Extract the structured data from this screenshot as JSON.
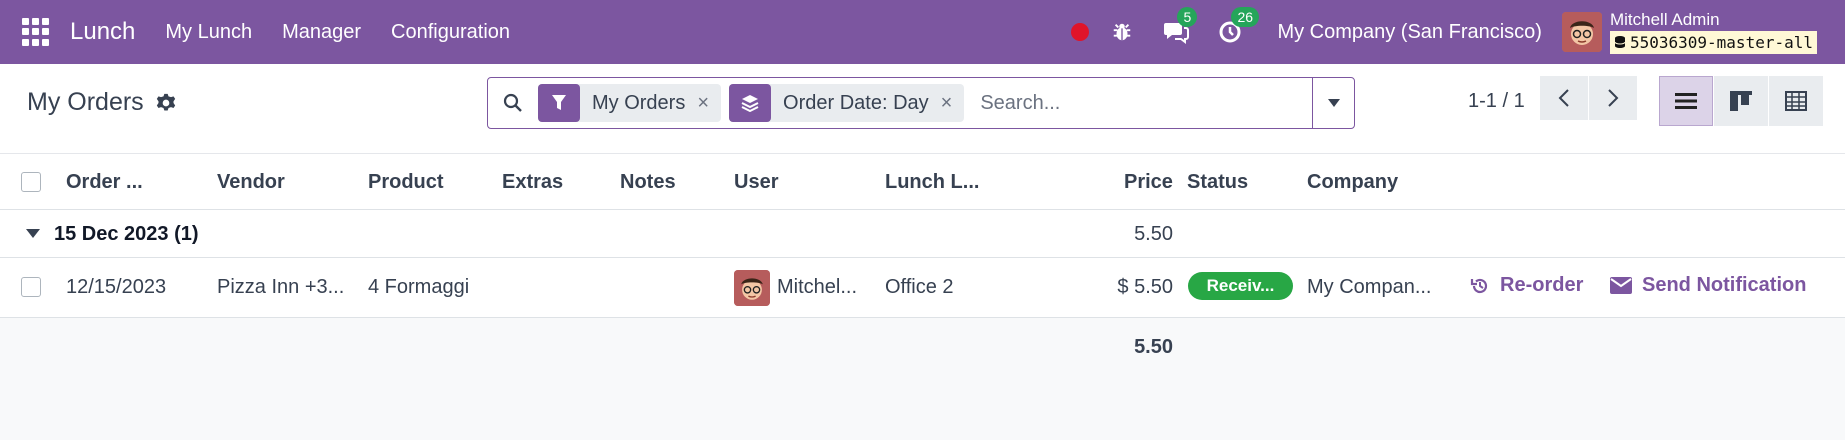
{
  "navbar": {
    "app_name": "Lunch",
    "menus": [
      "My Lunch",
      "Manager",
      "Configuration"
    ],
    "messages_count": "5",
    "activities_count": "26",
    "company": "My Company (San Francisco)",
    "user_name": "Mitchell Admin",
    "database": "55036309-master-all",
    "colors": {
      "brand": "#7c56a0",
      "badge": "#25a55a",
      "recording": "#e0142a"
    }
  },
  "control": {
    "title": "My Orders",
    "facets": [
      {
        "icon": "filter-icon",
        "label": "My Orders"
      },
      {
        "icon": "layers-icon",
        "label": "Order Date: Day"
      }
    ],
    "search_placeholder": "Search...",
    "pager": "1-1 / 1"
  },
  "table": {
    "headers": [
      "Order ...",
      "Vendor",
      "Product",
      "Extras",
      "Notes",
      "User",
      "Lunch L...",
      "Price",
      "Status",
      "Company"
    ],
    "group": {
      "label": "15 Dec 2023 (1)",
      "total": "5.50"
    },
    "rows": [
      {
        "order_date": "12/15/2023",
        "vendor": "Pizza Inn +3...",
        "product": "4 Formaggi",
        "extras": "",
        "notes": "",
        "user": "Mitchel...",
        "location": "Office 2",
        "price": "$ 5.50",
        "status": "Receiv...",
        "company": "My Compan...",
        "reorder_label": "Re-order",
        "notify_label": "Send Notification"
      }
    ],
    "grand_total": "5.50",
    "status_color": "#28a745"
  }
}
